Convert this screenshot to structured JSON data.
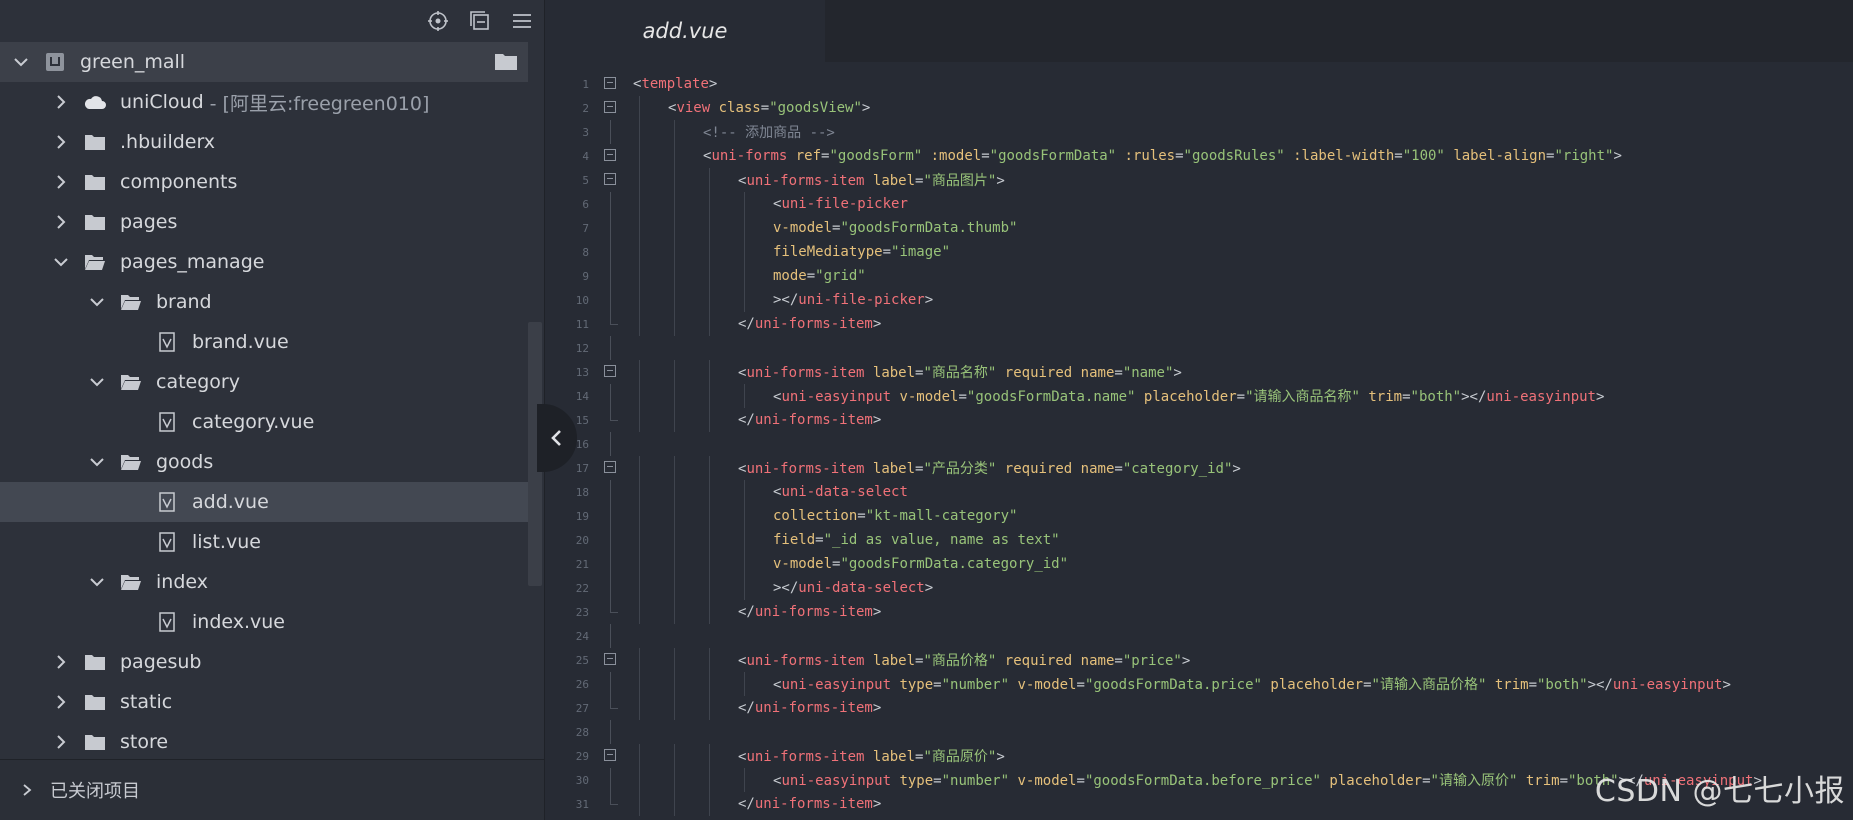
{
  "sidebar": {
    "toolbar": {
      "icons": [
        "locate-icon",
        "collapse-all-icon",
        "menu-icon"
      ]
    },
    "project": {
      "name": "green_mall"
    },
    "tree": [
      {
        "label": "uniCloud",
        "sub": "- [阿里云:freegreen010]",
        "type": "cloud",
        "depth": 0,
        "expanded": false
      },
      {
        "label": ".hbuilderx",
        "type": "folder",
        "depth": 0,
        "expanded": false
      },
      {
        "label": "components",
        "type": "folder",
        "depth": 0,
        "expanded": false
      },
      {
        "label": "pages",
        "type": "folder",
        "depth": 0,
        "expanded": false
      },
      {
        "label": "pages_manage",
        "type": "folder-open",
        "depth": 0,
        "expanded": true
      },
      {
        "label": "brand",
        "type": "folder-open",
        "depth": 1,
        "expanded": true
      },
      {
        "label": "brand.vue",
        "type": "file",
        "depth": 2
      },
      {
        "label": "category",
        "type": "folder-open",
        "depth": 1,
        "expanded": true
      },
      {
        "label": "category.vue",
        "type": "file",
        "depth": 2
      },
      {
        "label": "goods",
        "type": "folder-open",
        "depth": 1,
        "expanded": true
      },
      {
        "label": "add.vue",
        "type": "file",
        "depth": 2,
        "selected": true
      },
      {
        "label": "list.vue",
        "type": "file",
        "depth": 2
      },
      {
        "label": "index",
        "type": "folder-open",
        "depth": 1,
        "expanded": true
      },
      {
        "label": "index.vue",
        "type": "file",
        "depth": 2
      },
      {
        "label": "pagesub",
        "type": "folder",
        "depth": 0,
        "expanded": false
      },
      {
        "label": "static",
        "type": "folder",
        "depth": 0,
        "expanded": false
      },
      {
        "label": "store",
        "type": "folder",
        "depth": 0,
        "expanded": false
      }
    ],
    "closed_projects_label": "已关闭项目"
  },
  "editor": {
    "active_tab": "add.vue",
    "lines": [
      {
        "n": "1",
        "fold": true,
        "indent": 0,
        "tokens": [
          [
            "pun",
            "<"
          ],
          [
            "tag",
            "template"
          ],
          [
            "pun",
            ">"
          ]
        ]
      },
      {
        "n": "2",
        "fold": true,
        "indent": 1,
        "tokens": [
          [
            "pun",
            "<"
          ],
          [
            "tag",
            "view"
          ],
          [
            "txt",
            " "
          ],
          [
            "attr",
            "class"
          ],
          [
            "pun",
            "="
          ],
          [
            "str",
            "\"goodsView\""
          ],
          [
            "pun",
            ">"
          ]
        ]
      },
      {
        "n": "3",
        "indent": 2,
        "tokens": [
          [
            "com",
            "<!-- 添加商品 -->"
          ]
        ]
      },
      {
        "n": "4",
        "fold": true,
        "indent": 2,
        "tokens": [
          [
            "pun",
            "<"
          ],
          [
            "tag",
            "uni-forms"
          ],
          [
            "txt",
            " "
          ],
          [
            "attr",
            "ref"
          ],
          [
            "pun",
            "="
          ],
          [
            "str",
            "\"goodsForm\""
          ],
          [
            "txt",
            " "
          ],
          [
            "attr",
            ":model"
          ],
          [
            "pun",
            "="
          ],
          [
            "str",
            "\"goodsFormData\""
          ],
          [
            "txt",
            " "
          ],
          [
            "attr",
            ":rules"
          ],
          [
            "pun",
            "="
          ],
          [
            "str",
            "\"goodsRules\""
          ],
          [
            "txt",
            " "
          ],
          [
            "attr",
            ":label-width"
          ],
          [
            "pun",
            "="
          ],
          [
            "str",
            "\"100\""
          ],
          [
            "txt",
            " "
          ],
          [
            "attr",
            "label-align"
          ],
          [
            "pun",
            "="
          ],
          [
            "str",
            "\"right\""
          ],
          [
            "pun",
            ">"
          ]
        ]
      },
      {
        "n": "5",
        "fold": true,
        "indent": 3,
        "tokens": [
          [
            "pun",
            "<"
          ],
          [
            "tag",
            "uni-forms-item"
          ],
          [
            "txt",
            " "
          ],
          [
            "attr",
            "label"
          ],
          [
            "pun",
            "="
          ],
          [
            "str",
            "\"商品图片\""
          ],
          [
            "pun",
            ">"
          ]
        ]
      },
      {
        "n": "6",
        "indent": 4,
        "tokens": [
          [
            "pun",
            "<"
          ],
          [
            "tag",
            "uni-file-picker"
          ]
        ]
      },
      {
        "n": "7",
        "indent": 4,
        "tokens": [
          [
            "attr",
            "v-model"
          ],
          [
            "pun",
            "="
          ],
          [
            "str",
            "\"goodsFormData.thumb\""
          ]
        ]
      },
      {
        "n": "8",
        "indent": 4,
        "tokens": [
          [
            "attr",
            "fileMediatype"
          ],
          [
            "pun",
            "="
          ],
          [
            "str",
            "\"image\""
          ]
        ]
      },
      {
        "n": "9",
        "indent": 4,
        "tokens": [
          [
            "attr",
            "mode"
          ],
          [
            "pun",
            "="
          ],
          [
            "str",
            "\"grid\""
          ]
        ]
      },
      {
        "n": "10",
        "indent": 4,
        "tokens": [
          [
            "pun",
            "></"
          ],
          [
            "tag",
            "uni-file-picker"
          ],
          [
            "pun",
            ">"
          ]
        ]
      },
      {
        "n": "11",
        "end": true,
        "indent": 3,
        "tokens": [
          [
            "pun",
            "</"
          ],
          [
            "tag",
            "uni-forms-item"
          ],
          [
            "pun",
            ">"
          ]
        ]
      },
      {
        "n": "12",
        "indent": 0,
        "tokens": []
      },
      {
        "n": "13",
        "fold": true,
        "indent": 3,
        "tokens": [
          [
            "pun",
            "<"
          ],
          [
            "tag",
            "uni-forms-item"
          ],
          [
            "txt",
            " "
          ],
          [
            "attr",
            "label"
          ],
          [
            "pun",
            "="
          ],
          [
            "str",
            "\"商品名称\""
          ],
          [
            "txt",
            " "
          ],
          [
            "attr",
            "required"
          ],
          [
            "txt",
            " "
          ],
          [
            "attr",
            "name"
          ],
          [
            "pun",
            "="
          ],
          [
            "str",
            "\"name\""
          ],
          [
            "pun",
            ">"
          ]
        ]
      },
      {
        "n": "14",
        "indent": 4,
        "tokens": [
          [
            "pun",
            "<"
          ],
          [
            "tag",
            "uni-easyinput"
          ],
          [
            "txt",
            " "
          ],
          [
            "attr",
            "v-model"
          ],
          [
            "pun",
            "="
          ],
          [
            "str",
            "\"goodsFormData.name\""
          ],
          [
            "txt",
            " "
          ],
          [
            "attr",
            "placeholder"
          ],
          [
            "pun",
            "="
          ],
          [
            "str",
            "\"请输入商品名称\""
          ],
          [
            "txt",
            " "
          ],
          [
            "attr",
            "trim"
          ],
          [
            "pun",
            "="
          ],
          [
            "str",
            "\"both\""
          ],
          [
            "pun",
            "></"
          ],
          [
            "tag",
            "uni-easyinput"
          ],
          [
            "pun",
            ">"
          ]
        ]
      },
      {
        "n": "15",
        "end": true,
        "indent": 3,
        "tokens": [
          [
            "pun",
            "</"
          ],
          [
            "tag",
            "uni-forms-item"
          ],
          [
            "pun",
            ">"
          ]
        ]
      },
      {
        "n": "16",
        "indent": 0,
        "tokens": []
      },
      {
        "n": "17",
        "fold": true,
        "indent": 3,
        "tokens": [
          [
            "pun",
            "<"
          ],
          [
            "tag",
            "uni-forms-item"
          ],
          [
            "txt",
            " "
          ],
          [
            "attr",
            "label"
          ],
          [
            "pun",
            "="
          ],
          [
            "str",
            "\"产品分类\""
          ],
          [
            "txt",
            " "
          ],
          [
            "attr",
            "required"
          ],
          [
            "txt",
            " "
          ],
          [
            "attr",
            "name"
          ],
          [
            "pun",
            "="
          ],
          [
            "str",
            "\"category_id\""
          ],
          [
            "pun",
            ">"
          ]
        ]
      },
      {
        "n": "18",
        "indent": 4,
        "tokens": [
          [
            "pun",
            "<"
          ],
          [
            "tag",
            "uni-data-select"
          ]
        ]
      },
      {
        "n": "19",
        "indent": 4,
        "tokens": [
          [
            "attr",
            "collection"
          ],
          [
            "pun",
            "="
          ],
          [
            "str",
            "\"kt-mall-category\""
          ]
        ]
      },
      {
        "n": "20",
        "indent": 4,
        "tokens": [
          [
            "attr",
            "field"
          ],
          [
            "pun",
            "="
          ],
          [
            "str",
            "\"_id as value, name as text\""
          ]
        ]
      },
      {
        "n": "21",
        "indent": 4,
        "tokens": [
          [
            "attr",
            "v-model"
          ],
          [
            "pun",
            "="
          ],
          [
            "str",
            "\"goodsFormData.category_id\""
          ]
        ]
      },
      {
        "n": "22",
        "indent": 4,
        "tokens": [
          [
            "pun",
            "></"
          ],
          [
            "tag",
            "uni-data-select"
          ],
          [
            "pun",
            ">"
          ]
        ]
      },
      {
        "n": "23",
        "end": true,
        "indent": 3,
        "tokens": [
          [
            "pun",
            "</"
          ],
          [
            "tag",
            "uni-forms-item"
          ],
          [
            "pun",
            ">"
          ]
        ]
      },
      {
        "n": "24",
        "indent": 0,
        "tokens": []
      },
      {
        "n": "25",
        "fold": true,
        "indent": 3,
        "tokens": [
          [
            "pun",
            "<"
          ],
          [
            "tag",
            "uni-forms-item"
          ],
          [
            "txt",
            " "
          ],
          [
            "attr",
            "label"
          ],
          [
            "pun",
            "="
          ],
          [
            "str",
            "\"商品价格\""
          ],
          [
            "txt",
            " "
          ],
          [
            "attr",
            "required"
          ],
          [
            "txt",
            " "
          ],
          [
            "attr",
            "name"
          ],
          [
            "pun",
            "="
          ],
          [
            "str",
            "\"price\""
          ],
          [
            "pun",
            ">"
          ]
        ]
      },
      {
        "n": "26",
        "indent": 4,
        "tokens": [
          [
            "pun",
            "<"
          ],
          [
            "tag",
            "uni-easyinput"
          ],
          [
            "txt",
            " "
          ],
          [
            "attr",
            "type"
          ],
          [
            "pun",
            "="
          ],
          [
            "str",
            "\"number\""
          ],
          [
            "txt",
            " "
          ],
          [
            "attr",
            "v-model"
          ],
          [
            "pun",
            "="
          ],
          [
            "str",
            "\"goodsFormData.price\""
          ],
          [
            "txt",
            " "
          ],
          [
            "attr",
            "placeholder"
          ],
          [
            "pun",
            "="
          ],
          [
            "str",
            "\"请输入商品价格\""
          ],
          [
            "txt",
            " "
          ],
          [
            "attr",
            "trim"
          ],
          [
            "pun",
            "="
          ],
          [
            "str",
            "\"both\""
          ],
          [
            "pun",
            "></"
          ],
          [
            "tag",
            "uni-easyinput"
          ],
          [
            "pun",
            ">"
          ]
        ]
      },
      {
        "n": "27",
        "end": true,
        "indent": 3,
        "tokens": [
          [
            "pun",
            "</"
          ],
          [
            "tag",
            "uni-forms-item"
          ],
          [
            "pun",
            ">"
          ]
        ]
      },
      {
        "n": "28",
        "indent": 0,
        "tokens": []
      },
      {
        "n": "29",
        "fold": true,
        "indent": 3,
        "tokens": [
          [
            "pun",
            "<"
          ],
          [
            "tag",
            "uni-forms-item"
          ],
          [
            "txt",
            " "
          ],
          [
            "attr",
            "label"
          ],
          [
            "pun",
            "="
          ],
          [
            "str",
            "\"商品原价\""
          ],
          [
            "pun",
            ">"
          ]
        ]
      },
      {
        "n": "30",
        "indent": 4,
        "tokens": [
          [
            "pun",
            "<"
          ],
          [
            "tag",
            "uni-easyinput"
          ],
          [
            "txt",
            " "
          ],
          [
            "attr",
            "type"
          ],
          [
            "pun",
            "="
          ],
          [
            "str",
            "\"number\""
          ],
          [
            "txt",
            " "
          ],
          [
            "attr",
            "v-model"
          ],
          [
            "pun",
            "="
          ],
          [
            "str",
            "\"goodsFormData.before_price\""
          ],
          [
            "txt",
            " "
          ],
          [
            "attr",
            "placeholder"
          ],
          [
            "pun",
            "="
          ],
          [
            "str",
            "\"请输入原价\""
          ],
          [
            "txt",
            " "
          ],
          [
            "attr",
            "trim"
          ],
          [
            "pun",
            "="
          ],
          [
            "str",
            "\"both\""
          ],
          [
            "pun",
            "></"
          ],
          [
            "tag",
            "uni-easyinput"
          ],
          [
            "pun",
            ">"
          ]
        ]
      },
      {
        "n": "31",
        "end": true,
        "indent": 3,
        "tokens": [
          [
            "pun",
            "</"
          ],
          [
            "tag",
            "uni-forms-item"
          ],
          [
            "pun",
            ">"
          ]
        ]
      }
    ]
  },
  "watermark": "CSDN @七七小报",
  "colors": {
    "tag": "#f07178",
    "attr": "#e5c07b",
    "string": "#98c379",
    "comment": "#7f8693",
    "sidebar_bg": "#2d313a",
    "editor_bg": "#272b34"
  }
}
